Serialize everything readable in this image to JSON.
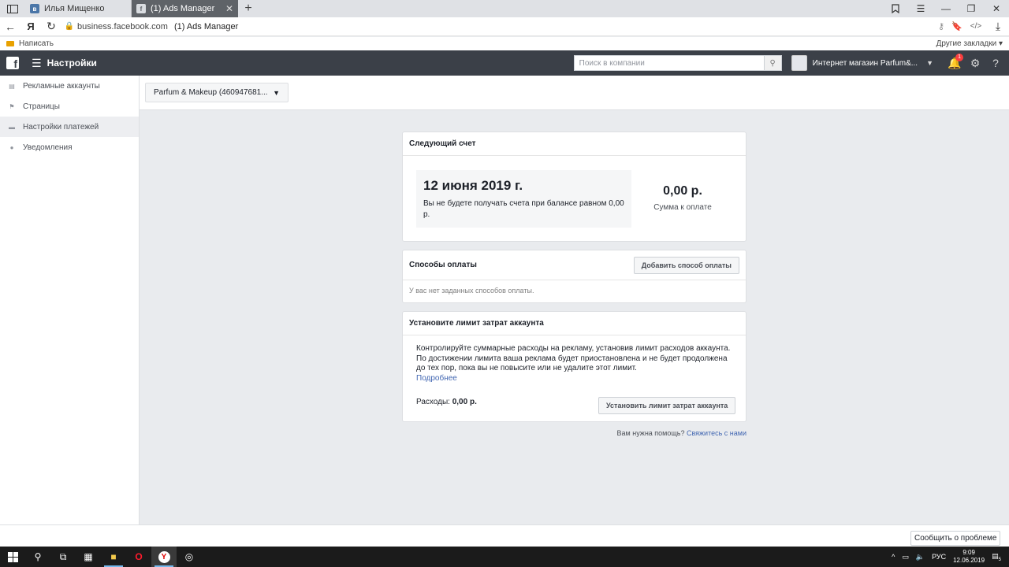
{
  "browser": {
    "tabs": [
      {
        "label": "Илья Мищенко",
        "favicon": "vk-icon",
        "active": false
      },
      {
        "label": "(1) Ads Manager",
        "favicon": "facebook-icon",
        "active": true
      }
    ],
    "url_host": "business.facebook.com",
    "url_title": "(1) Ads Manager",
    "bookmarks": {
      "left": "Написать",
      "right": "Другие закладки ▾"
    }
  },
  "header": {
    "title": "Настройки",
    "search_placeholder": "Поиск в компании",
    "business_name": "Интернет магазин Parfum&...",
    "notification_count": "1"
  },
  "sidebar": {
    "items": [
      {
        "label": "Рекламные аккаунты",
        "icon": "ad-accounts-icon"
      },
      {
        "label": "Страницы",
        "icon": "flag-icon"
      },
      {
        "label": "Настройки платежей",
        "icon": "credit-card-icon"
      },
      {
        "label": "Уведомления",
        "icon": "globe-icon"
      }
    ]
  },
  "account_selector": {
    "label": "Parfum & Makeup (460947681..."
  },
  "next_invoice": {
    "title": "Следующий счет",
    "date": "12 июня 2019 г.",
    "note": "Вы не будете получать счета при балансе равном 0,00 р.",
    "amount": "0,00 р.",
    "amount_label": "Сумма к оплате"
  },
  "payment_methods": {
    "title": "Способы оплаты",
    "add_button": "Добавить способ оплаты",
    "empty_text": "У вас нет заданных способов оплаты."
  },
  "spend_limit": {
    "title": "Установите лимит затрат аккаунта",
    "description": "Контролируйте суммарные расходы на рекламу, установив лимит расходов аккаунта. По достижении лимита ваша реклама будет приостановлена и не будет продолжена до тех пор, пока вы не повысите или не удалите этот лимит.",
    "more_link": "Подробнее",
    "spend_label": "Расходы:",
    "spend_value": "0,00 р.",
    "button": "Установить лимит затрат аккаунта"
  },
  "help": {
    "question": "Вам нужна помощь?",
    "link": "Свяжитесь с нами"
  },
  "report_button": "Сообщить о проблеме",
  "taskbar": {
    "lang": "РУС",
    "time": "9:09",
    "date": "12.06.2019",
    "notif_count": "5"
  },
  "colors": {
    "header_bg": "#3b4048",
    "link": "#4267b2",
    "page_bg": "#e9ebee",
    "badge": "#fa3e3e"
  }
}
